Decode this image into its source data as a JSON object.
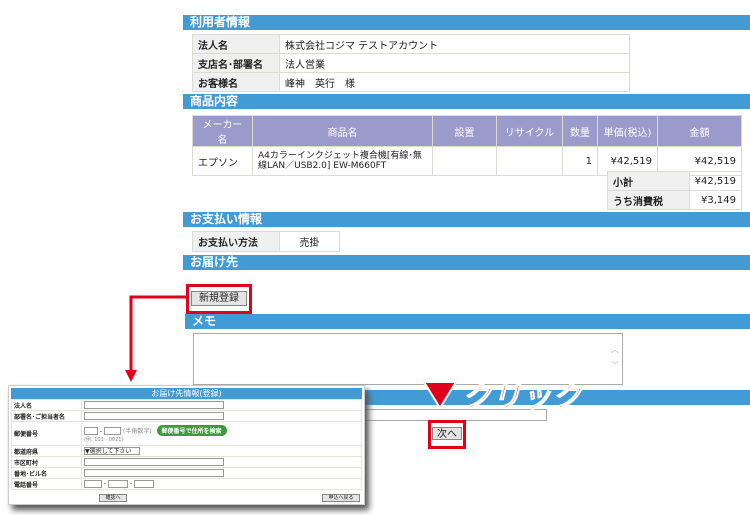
{
  "sections": {
    "user": "利用者情報",
    "products": "商品内容",
    "payment": "お支払い情報",
    "delivery": "お届け先",
    "memo": "メモ"
  },
  "user_info": [
    {
      "label": "法人名",
      "value": "株式会社コジマ テストアカウント"
    },
    {
      "label": "支店名･部署名",
      "value": "法人営業"
    },
    {
      "label": "お客様名",
      "value": "峰神　英行　様"
    }
  ],
  "product_table": {
    "headers": [
      "メーカー名",
      "商品名",
      "設置",
      "リサイクル",
      "数量",
      "単価(税込)",
      "金額"
    ],
    "rows": [
      [
        "エプソン",
        "A4カラーインクジェット複合機[有線･無線LAN／USB2.0] EW-M660FT",
        "",
        "",
        "1",
        "¥42,519",
        "¥42,519"
      ]
    ]
  },
  "summary": [
    {
      "label": "小計",
      "value": "¥42,519"
    },
    {
      "label": "うち消費税",
      "value": "¥3,149"
    }
  ],
  "payment": {
    "label": "お支払い方法",
    "value": "売掛"
  },
  "buttons": {
    "new_register": "新規登録",
    "next": "次へ"
  },
  "annotation": {
    "click": "クリック",
    "accent": "#e0001b"
  },
  "popup": {
    "title": "お届け先情報(登録)",
    "fields": [
      "法人名",
      "部署名･ご担当者名",
      "郵便番号",
      "都道府県",
      "市区町村",
      "番地･ビル名",
      "電話番号"
    ],
    "zip_hint": "(半角数字)",
    "zip_example": "(例:  101  -  0021)",
    "zip_search_button": "郵便番号で住所を検索",
    "prefecture_select": "▼選択して下さい",
    "confirm_button": "確認へ",
    "back_button": "申込へ戻る"
  },
  "colors": {
    "section_header": "#439bd6",
    "table_header": "#9a9acb"
  }
}
